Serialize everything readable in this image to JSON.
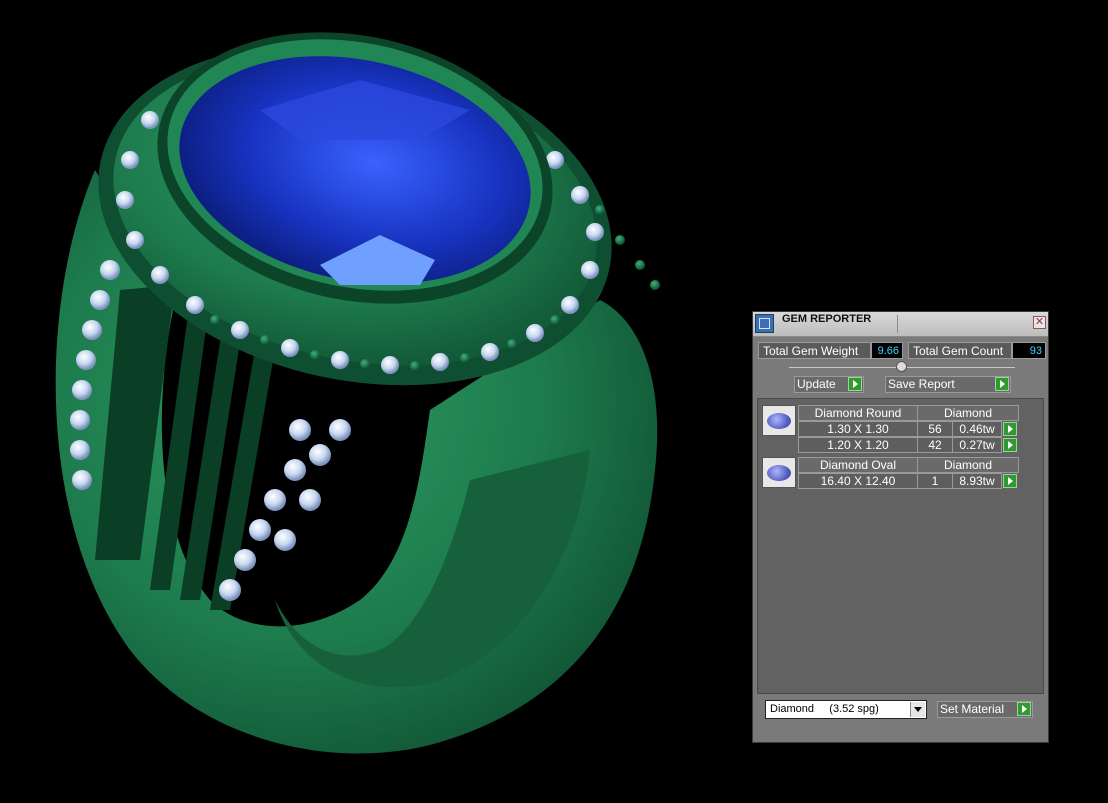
{
  "panel": {
    "title": "GEM REPORTER",
    "close_glyph": "✕",
    "total_weight_label": "Total Gem Weight",
    "total_weight_value": "9.66",
    "total_count_label": "Total Gem Count",
    "total_count_value": "93",
    "update_label": "Update",
    "save_report_label": "Save Report",
    "groups": [
      {
        "name": "Diamond Round",
        "material": "Diamond",
        "rows": [
          {
            "size": "1.30 X 1.30",
            "count": "56",
            "weight": "0.46tw"
          },
          {
            "size": "1.20 X 1.20",
            "count": "42",
            "weight": "0.27tw"
          }
        ]
      },
      {
        "name": "Diamond Oval",
        "material": "Diamond",
        "rows": [
          {
            "size": "16.40 X 12.40",
            "count": "1",
            "weight": "8.93tw"
          }
        ]
      }
    ],
    "material_select_value": "Diamond     (3.52 spg)",
    "set_material_label": "Set Material"
  },
  "colors": {
    "ring_metal": "#1e7a4c",
    "center_stone": "#1a35c8",
    "accent_value": "#3cd5ff",
    "action_green": "#2f9a2f"
  }
}
